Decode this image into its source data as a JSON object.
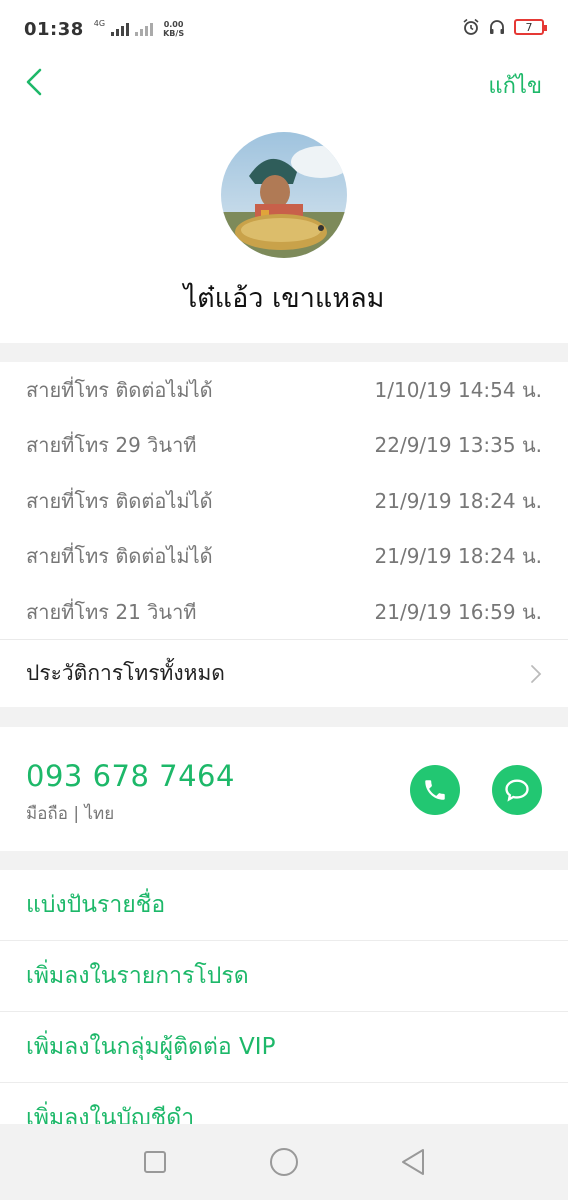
{
  "status_bar": {
    "time": "01:38",
    "network": "4G",
    "speed_value": "0.00",
    "speed_unit": "KB/S",
    "battery_level": "7"
  },
  "header": {
    "back_icon": "chevron-left-icon",
    "edit_label": "แก้ไข"
  },
  "contact": {
    "name": "ไต๋แอ้ว เขาแหลม"
  },
  "call_log": [
    {
      "status": "สายที่โทร ติดต่อไม่ได้",
      "time": "1/10/19 14:54 น."
    },
    {
      "status": "สายที่โทร  29 วินาที",
      "time": "22/9/19 13:35 น."
    },
    {
      "status": "สายที่โทร ติดต่อไม่ได้",
      "time": "21/9/19 18:24 น."
    },
    {
      "status": "สายที่โทร ติดต่อไม่ได้",
      "time": "21/9/19 18:24 น."
    },
    {
      "status": "สายที่โทร  21 วินาที",
      "time": "21/9/19 16:59 น."
    }
  ],
  "all_history_label": "ประวัติการโทรทั้งหมด",
  "phone": {
    "number": "093 678 7464",
    "meta": "มือถือ | ไทย"
  },
  "actions": [
    {
      "label": "แบ่งปันรายชื่อ"
    },
    {
      "label": "เพิ่มลงในรายการโปรด"
    },
    {
      "label": "เพิ่มลงในกลุ่มผู้ติดต่อ VIP"
    },
    {
      "label": "เพิ่มลงในบัญชีดำ"
    }
  ],
  "colors": {
    "accent": "#1db869",
    "button_green": "#22c772",
    "battery_red": "#e53935"
  }
}
